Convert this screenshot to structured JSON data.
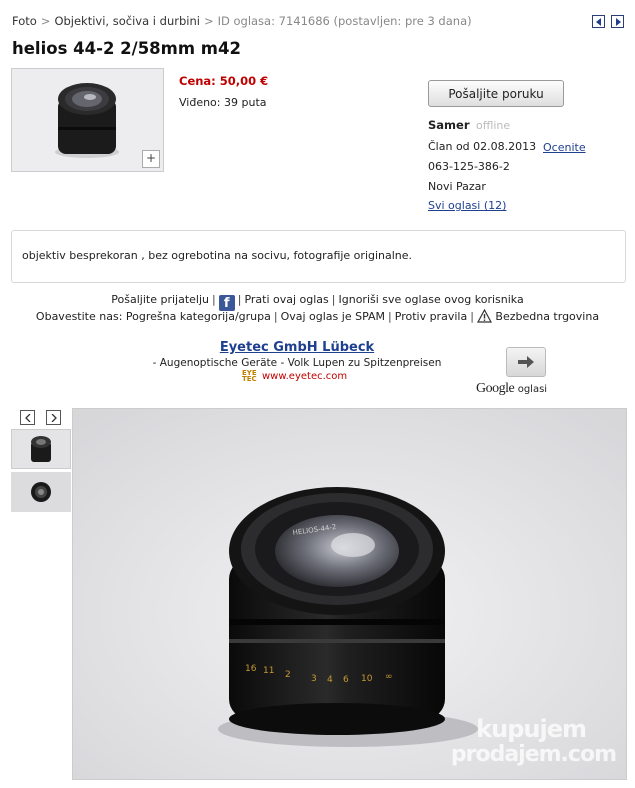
{
  "breadcrumb": {
    "items": [
      "Foto",
      "Objektivi, sočiva i durbini"
    ],
    "separator": ">",
    "meta": "ID oglasa: 7141686 (postavljen: pre 3 dana)"
  },
  "title": "helios 44-2 2/58mm m42",
  "listing": {
    "price": "Cena: 50,00 €",
    "views": "Viđeno: 39 puta",
    "thumb_plus": "+"
  },
  "seller": {
    "send_message": "Pošaljite poruku",
    "name": "Samer",
    "status": "offline",
    "member_since": "Član od 02.08.2013",
    "rate_link": "Ocenite",
    "phone": "063-125-386-2",
    "city": "Novi Pazar",
    "all_ads": "Svi oglasi (12)"
  },
  "description": "objektiv besprekoran , bez ogrebotina na socivu, fotografije originalne.",
  "actions": {
    "send_friend": "Pošaljite prijatelju",
    "follow": "Prati ovaj oglas",
    "ignore": "Ignoriši sve oglase ovog korisnika",
    "report_label": "Obavestite nas:",
    "wrong_category": "Pogrešna kategorija/grupa",
    "spam": "Ovaj oglas je SPAM",
    "against_rules": "Protiv pravila",
    "safe_trade": "Bezbedna trgovina"
  },
  "ad": {
    "title": "Eyetec GmbH Lübeck",
    "text": "- Augenoptische Geräte - Volk Lupen zu Spitzenpreisen",
    "logo_text": "EYE TEC",
    "url": "www.eyetec.com",
    "google": "Google",
    "google_suffix": "oglasi"
  },
  "watermark": {
    "line1": "kupujem",
    "line2": "prodajem.com"
  },
  "colors": {
    "price": "#c00000",
    "link": "#1f3f8f",
    "status_offline": "#bbbbbb"
  },
  "icons": [
    "chevron-left-icon",
    "chevron-right-icon",
    "facebook-icon",
    "warning-icon",
    "arrow-right-icon",
    "plus-icon"
  ]
}
